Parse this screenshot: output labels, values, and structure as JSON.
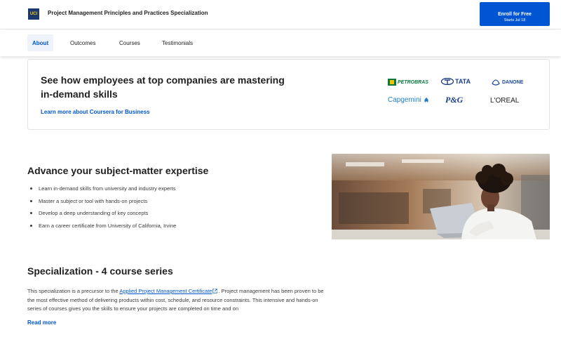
{
  "header": {
    "logo_text": "UCI",
    "title": "Project Management Principles and Practices Specialization",
    "enroll_label": "Enroll for Free",
    "enroll_sub": "Starts Jul 18"
  },
  "tabs": [
    {
      "label": "About",
      "active": true
    },
    {
      "label": "Outcomes",
      "active": false
    },
    {
      "label": "Courses",
      "active": false
    },
    {
      "label": "Testimonials",
      "active": false
    }
  ],
  "business": {
    "title": "See how employees at top companies are mastering in-demand skills",
    "link": "Learn more about Coursera for Business",
    "brands": [
      "PETROBRAS",
      "TATA",
      "DANONE",
      "Capgemini",
      "P&G",
      "L'OREAL"
    ]
  },
  "expertise": {
    "title": "Advance your subject-matter expertise",
    "items": [
      "Learn in-demand skills from university and industry experts",
      "Master a subject or tool with hands-on projects",
      "Develop a deep understanding of key concepts",
      "Earn a career certificate from University of California, Irvine"
    ]
  },
  "specialization": {
    "title": "Specialization - 4 course series",
    "text_before": "This specialization is a precursor to the ",
    "link": "Applied Project Management Certificate",
    "text_after": ". Project management has been proven to be the most effective method of delivering products within cost, schedule, and resource constraints. This intensive and hands-on series of courses gives you the skills to ensure your projects are completed on time and on",
    "read_more": "Read more"
  },
  "colors": {
    "accent": "#0056d2",
    "logo_bg": "#1b3a6b",
    "logo_fg": "#f5c518"
  }
}
